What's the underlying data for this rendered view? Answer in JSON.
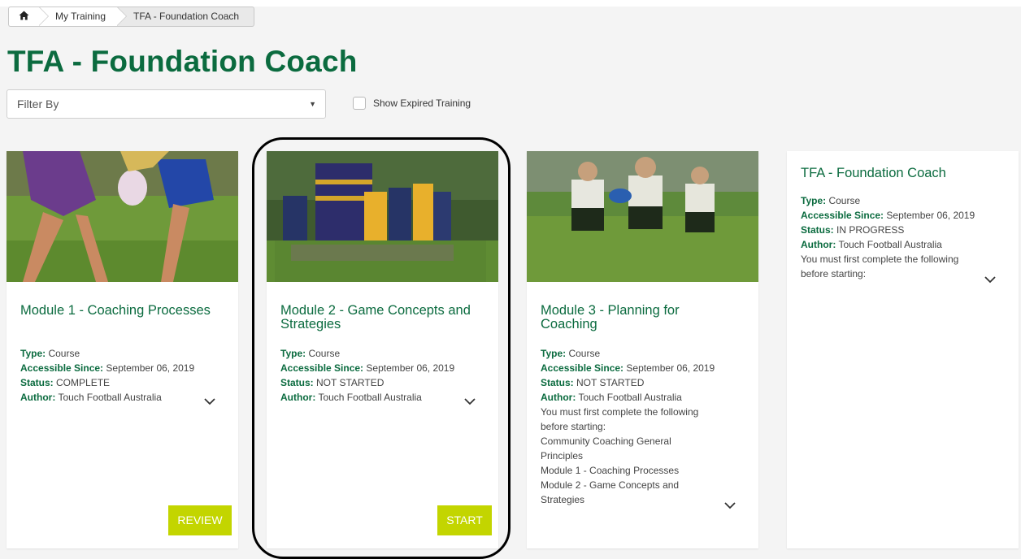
{
  "breadcrumb": {
    "items": [
      {
        "label": "My Training"
      },
      {
        "label": "TFA - Foundation Coach"
      }
    ]
  },
  "page": {
    "title": "TFA - Foundation Coach"
  },
  "filter": {
    "value": "Filter By"
  },
  "show_expired": {
    "label": "Show Expired Training",
    "checked": false
  },
  "labels": {
    "type": "Type:",
    "accessible": "Accessible Since:",
    "status": "Status:",
    "author": "Author:"
  },
  "modules": [
    {
      "title": "Module 1 - Coaching Processes",
      "type": "Course",
      "accessible_since": "September 06, 2019",
      "status": "COMPLETE",
      "author": "Touch Football Australia",
      "button": "REVIEW"
    },
    {
      "title": "Module 2 - Game Concepts and Strategies",
      "type": "Course",
      "accessible_since": "September 06, 2019",
      "status": "NOT STARTED",
      "author": "Touch Football Australia",
      "button": "START"
    },
    {
      "title": "Module 3 - Planning for Coaching",
      "type": "Course",
      "accessible_since": "September 06, 2019",
      "status": "NOT STARTED",
      "author": "Touch Football Australia",
      "prereq_note": "You must first complete the following before starting:",
      "prerequisites": [
        "Community Coaching General Principles",
        "Module 1 - Coaching Processes",
        "Module 2 - Game Concepts and Strategies"
      ]
    }
  ],
  "summary": {
    "title": "TFA - Foundation Coach",
    "type": "Course",
    "accessible_since": "September 06, 2019",
    "status": "IN PROGRESS",
    "author": "Touch Football Australia",
    "prereq_note": "You must first complete the following before starting:"
  },
  "colors": {
    "brand_green": "#0b6b3f",
    "action_button": "#c3d500",
    "background": "#f4f4f4"
  },
  "icons": {
    "home": "home-icon",
    "expand": "chevron-down-icon",
    "dropdown": "caret-down-icon"
  }
}
